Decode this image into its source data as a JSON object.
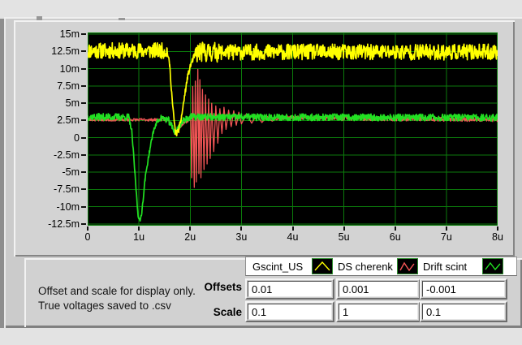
{
  "note": {
    "line1": "Offset and scale for display only.",
    "line2": "True voltages saved to .csv"
  },
  "controls": {
    "offsets_label": "Offsets",
    "scale_label": "Scale",
    "offsets": [
      "0.01",
      "0.001",
      "-0.001"
    ],
    "scale": [
      "0.1",
      "1",
      "0.1"
    ]
  },
  "legend": {
    "items": [
      {
        "label": "Gscint_US",
        "color": "#ffff00",
        "glyph": "peak"
      },
      {
        "label": "DS cherenk",
        "color": "#f25555",
        "glyph": "zigzag"
      },
      {
        "label": "Drift scint",
        "color": "#22e022",
        "glyph": "zigzag2"
      }
    ]
  },
  "chart_data": {
    "type": "line",
    "title": "",
    "xlabel": "",
    "ylabel": "",
    "x_unit": "u (microseconds)",
    "y_unit": "m (milli-volts)",
    "x_tick_labels": [
      "0",
      "1u",
      "2u",
      "3u",
      "4u",
      "5u",
      "6u",
      "7u",
      "8u"
    ],
    "x_tick_values": [
      0,
      1,
      2,
      3,
      4,
      5,
      6,
      7,
      8
    ],
    "y_tick_labels": [
      "15m",
      "12.5m",
      "10m",
      "7.5m",
      "5m",
      "2.5m",
      "0",
      "-2.5m",
      "-5m",
      "-7.5m",
      "-10m",
      "-12.5m"
    ],
    "y_tick_values": [
      15,
      12.5,
      10,
      7.5,
      5,
      2.5,
      0,
      -2.5,
      -5,
      -7.5,
      -10,
      -12.5
    ],
    "xlim": [
      0,
      8
    ],
    "ylim": [
      -12.75,
      15.25
    ],
    "grid": true,
    "grid_color": "#0b7a0b",
    "plot_bg": "#000000",
    "legend_position": "bottom",
    "draw_order": [
      1,
      2,
      0
    ],
    "series": [
      {
        "name": "Gscint_US",
        "color": "#ffff00",
        "width": 1.7,
        "seed": 11,
        "keypoints": [
          [
            0,
            12.6
          ],
          [
            1.55,
            12.6
          ],
          [
            1.6,
            10.5
          ],
          [
            1.66,
            4.5
          ],
          [
            1.71,
            0.8
          ],
          [
            1.74,
            0.6
          ],
          [
            1.78,
            1.2
          ],
          [
            1.83,
            3
          ],
          [
            1.89,
            6
          ],
          [
            1.95,
            8.8
          ],
          [
            2.02,
            10.8
          ],
          [
            2.08,
            11.8
          ],
          [
            2.15,
            12.4
          ],
          [
            8,
            12.4
          ]
        ],
        "noise": [
          [
            0,
            1.56,
            1.15
          ],
          [
            1.56,
            2.1,
            0.4
          ],
          [
            2.1,
            2.55,
            1.45
          ],
          [
            2.55,
            8,
            1.15
          ]
        ]
      },
      {
        "name": "DS cherenk",
        "color": "#f25555",
        "width": 1.3,
        "seed": 23,
        "keypoints": [
          [
            0,
            2.6
          ],
          [
            1.58,
            2.6
          ],
          [
            1.64,
            1.8
          ],
          [
            1.7,
            0.7
          ],
          [
            1.76,
            1.1
          ],
          [
            1.85,
            2.0
          ],
          [
            1.95,
            2.4
          ],
          [
            2.01,
            2.6
          ],
          [
            2.03,
            -5.8
          ],
          [
            2.05,
            7.4
          ],
          [
            2.08,
            -7.2
          ],
          [
            2.1,
            8.2
          ],
          [
            2.12,
            -6.4
          ],
          [
            2.15,
            9.9
          ],
          [
            2.17,
            -5.2
          ],
          [
            2.19,
            8.4
          ],
          [
            2.21,
            -5.8
          ],
          [
            2.24,
            7.0
          ],
          [
            2.27,
            -4.6
          ],
          [
            2.3,
            6.2
          ],
          [
            2.33,
            -3.8
          ],
          [
            2.36,
            5.6
          ],
          [
            2.39,
            -3.0
          ],
          [
            2.42,
            5.0
          ],
          [
            2.46,
            -2.0
          ],
          [
            2.5,
            4.6
          ],
          [
            2.54,
            -0.8
          ],
          [
            2.58,
            4.2
          ],
          [
            2.62,
            0.6
          ],
          [
            2.66,
            4.4
          ],
          [
            2.7,
            1.2
          ],
          [
            2.75,
            4.0
          ],
          [
            2.8,
            1.6
          ],
          [
            2.85,
            3.9
          ],
          [
            2.9,
            1.8
          ],
          [
            2.95,
            3.7
          ],
          [
            3.0,
            2.0
          ],
          [
            3.1,
            3.5
          ],
          [
            3.2,
            2.1
          ],
          [
            3.3,
            3.3
          ],
          [
            3.4,
            2.2
          ],
          [
            3.5,
            3.1
          ],
          [
            3.6,
            2.4
          ],
          [
            3.7,
            2.9
          ],
          [
            8,
            2.6
          ]
        ],
        "noise": [
          [
            0,
            1.96,
            0.2
          ],
          [
            1.96,
            3.68,
            0
          ],
          [
            3.68,
            8,
            0.3
          ]
        ]
      },
      {
        "name": "Drift scint",
        "color": "#22e022",
        "width": 1.7,
        "seed": 37,
        "keypoints": [
          [
            0,
            3.0
          ],
          [
            0.8,
            3.0
          ],
          [
            0.86,
            1.0
          ],
          [
            0.92,
            -5.0
          ],
          [
            0.98,
            -11.0
          ],
          [
            1.02,
            -12.2
          ],
          [
            1.06,
            -10.5
          ],
          [
            1.12,
            -6.0
          ],
          [
            1.2,
            -2.2
          ],
          [
            1.28,
            0.9
          ],
          [
            1.36,
            2.4
          ],
          [
            1.45,
            2.9
          ],
          [
            1.58,
            2.5
          ],
          [
            1.65,
            1.5
          ],
          [
            1.7,
            0.9
          ],
          [
            1.75,
            1.2
          ],
          [
            1.82,
            2.1
          ],
          [
            1.92,
            2.8
          ],
          [
            2.0,
            3.0
          ],
          [
            8,
            2.9
          ]
        ],
        "noise": [
          [
            0,
            0.83,
            0.5
          ],
          [
            0.83,
            1.42,
            0.3
          ],
          [
            1.42,
            8,
            0.5
          ]
        ]
      }
    ]
  }
}
